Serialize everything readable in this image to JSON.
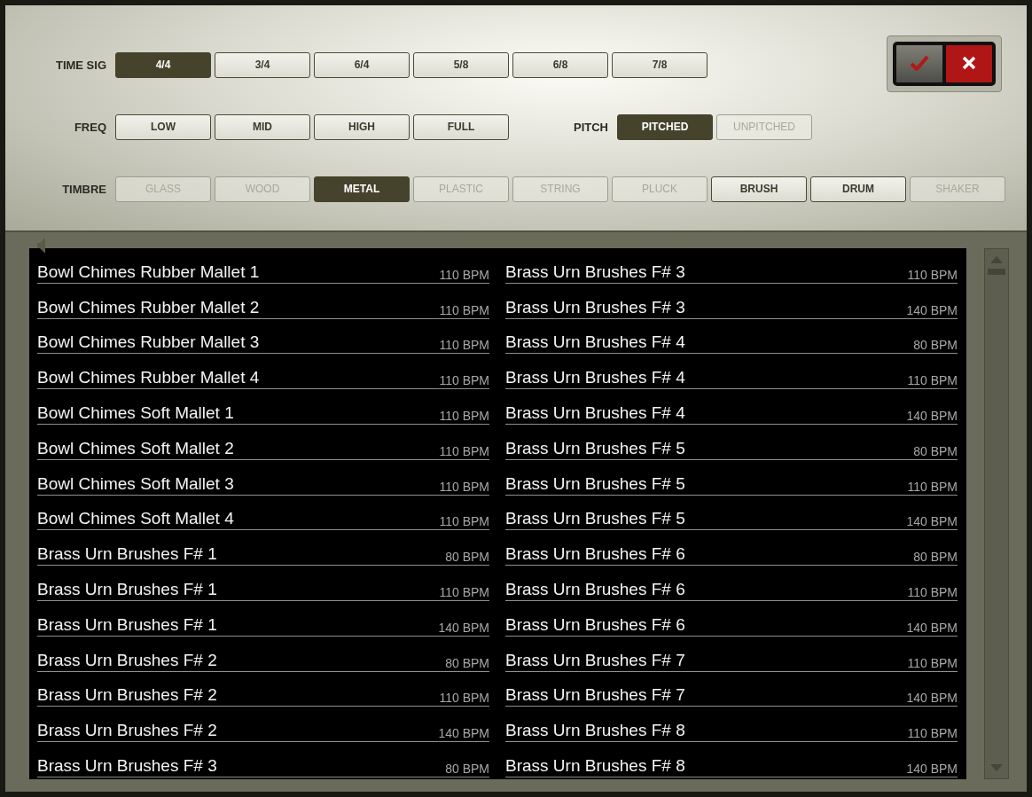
{
  "time_sig": {
    "label": "TIME SIG",
    "options": [
      {
        "label": "4/4",
        "selected": true,
        "disabled": false
      },
      {
        "label": "3/4",
        "selected": false,
        "disabled": false
      },
      {
        "label": "6/4",
        "selected": false,
        "disabled": false
      },
      {
        "label": "5/8",
        "selected": false,
        "disabled": false
      },
      {
        "label": "6/8",
        "selected": false,
        "disabled": false
      },
      {
        "label": "7/8",
        "selected": false,
        "disabled": false
      }
    ]
  },
  "freq": {
    "label": "FREQ",
    "options": [
      {
        "label": "LOW",
        "selected": false,
        "disabled": false
      },
      {
        "label": "MID",
        "selected": false,
        "disabled": false
      },
      {
        "label": "HIGH",
        "selected": false,
        "disabled": false
      },
      {
        "label": "FULL",
        "selected": false,
        "disabled": false
      }
    ]
  },
  "pitch": {
    "label": "PITCH",
    "options": [
      {
        "label": "PITCHED",
        "selected": true,
        "disabled": false
      },
      {
        "label": "UNPITCHED",
        "selected": false,
        "disabled": true
      }
    ]
  },
  "timbre": {
    "label": "TIMBRE",
    "options": [
      {
        "label": "GLASS",
        "selected": false,
        "disabled": true
      },
      {
        "label": "WOOD",
        "selected": false,
        "disabled": true
      },
      {
        "label": "METAL",
        "selected": true,
        "disabled": false
      },
      {
        "label": "PLASTIC",
        "selected": false,
        "disabled": true
      },
      {
        "label": "STRING",
        "selected": false,
        "disabled": true
      },
      {
        "label": "PLUCK",
        "selected": false,
        "disabled": true
      },
      {
        "label": "BRUSH",
        "selected": false,
        "disabled": false
      },
      {
        "label": "DRUM",
        "selected": false,
        "disabled": false
      },
      {
        "label": "SHAKER",
        "selected": false,
        "disabled": true
      }
    ]
  },
  "list": {
    "columns": [
      [
        {
          "name": "Bowl Chimes Rubber Mallet 1",
          "tempo": "110 BPM"
        },
        {
          "name": "Bowl Chimes Rubber Mallet 2",
          "tempo": "110 BPM"
        },
        {
          "name": "Bowl Chimes Rubber Mallet 3",
          "tempo": "110 BPM"
        },
        {
          "name": "Bowl Chimes Rubber Mallet 4",
          "tempo": "110 BPM"
        },
        {
          "name": "Bowl Chimes Soft Mallet 1",
          "tempo": "110 BPM"
        },
        {
          "name": "Bowl Chimes Soft Mallet 2",
          "tempo": "110 BPM"
        },
        {
          "name": "Bowl Chimes Soft Mallet 3",
          "tempo": "110 BPM"
        },
        {
          "name": "Bowl Chimes Soft Mallet 4",
          "tempo": "110 BPM"
        },
        {
          "name": "Brass Urn Brushes F# 1",
          "tempo": "80 BPM"
        },
        {
          "name": "Brass Urn Brushes F# 1",
          "tempo": "110 BPM"
        },
        {
          "name": "Brass Urn Brushes F# 1",
          "tempo": "140 BPM"
        },
        {
          "name": "Brass Urn Brushes F# 2",
          "tempo": "80 BPM"
        },
        {
          "name": "Brass Urn Brushes F# 2",
          "tempo": "110 BPM"
        },
        {
          "name": "Brass Urn Brushes F# 2",
          "tempo": "140 BPM"
        },
        {
          "name": "Brass Urn Brushes F# 3",
          "tempo": "80 BPM"
        }
      ],
      [
        {
          "name": "Brass Urn Brushes F# 3",
          "tempo": "110 BPM"
        },
        {
          "name": "Brass Urn Brushes F# 3",
          "tempo": "140 BPM"
        },
        {
          "name": "Brass Urn Brushes F# 4",
          "tempo": "80 BPM"
        },
        {
          "name": "Brass Urn Brushes F# 4",
          "tempo": "110 BPM"
        },
        {
          "name": "Brass Urn Brushes F# 4",
          "tempo": "140 BPM"
        },
        {
          "name": "Brass Urn Brushes F# 5",
          "tempo": "80 BPM"
        },
        {
          "name": "Brass Urn Brushes F# 5",
          "tempo": "110 BPM"
        },
        {
          "name": "Brass Urn Brushes F# 5",
          "tempo": "140 BPM"
        },
        {
          "name": "Brass Urn Brushes F# 6",
          "tempo": "80 BPM"
        },
        {
          "name": "Brass Urn Brushes F# 6",
          "tempo": "110 BPM"
        },
        {
          "name": "Brass Urn Brushes F# 6",
          "tempo": "140 BPM"
        },
        {
          "name": "Brass Urn Brushes F# 7",
          "tempo": "110 BPM"
        },
        {
          "name": "Brass Urn Brushes F# 7",
          "tempo": "140 BPM"
        },
        {
          "name": "Brass Urn Brushes F# 8",
          "tempo": "110 BPM"
        },
        {
          "name": "Brass Urn Brushes F# 8",
          "tempo": "140 BPM"
        }
      ]
    ]
  }
}
